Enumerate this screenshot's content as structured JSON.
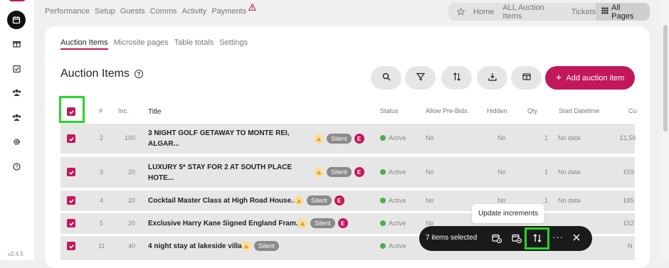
{
  "app": {
    "version": "v2.4.5"
  },
  "topnav": {
    "items": [
      "Performance",
      "Setup",
      "Guests",
      "Comms",
      "Activity",
      "Payments"
    ]
  },
  "breadcrumbs": {
    "home": "Home",
    "all_auction_items": "ALL Auction Items",
    "tickets": "Tickets",
    "all_pages": "All Pages"
  },
  "subtabs": [
    "Auction Items",
    "Microsite pages",
    "Table totals",
    "Settings"
  ],
  "page": {
    "title": "Auction Items",
    "add_button": "Add auction item"
  },
  "columns": {
    "num": "#",
    "inc": "Inc.",
    "title": "Title",
    "status": "Status",
    "allow_prebids": "Allow Pre-Bids",
    "hidden": "Hidden",
    "qty": "Qty",
    "start_datetime": "Start Datetime",
    "current": "Cu"
  },
  "rows": [
    {
      "num": "2",
      "inc": "100",
      "title_line1": "3 NIGHT GOLF GETAWAY TO MONTE REI,",
      "title_line2": "ALGAR...",
      "badge": "Silent",
      "e": "E",
      "status": "Active",
      "prebids": "No",
      "hidden": "No",
      "qty": "1",
      "start": "No data",
      "current": "£1,56"
    },
    {
      "num": "3",
      "inc": "20",
      "title_line1": "LUXURY 5* STAY FOR 2 AT SOUTH PLACE",
      "title_line2": "HOTE...",
      "badge": "Silent",
      "e": "E",
      "status": "Active",
      "prebids": "No",
      "hidden": "No",
      "qty": "1",
      "start": "No data",
      "current": "£59"
    },
    {
      "num": "4",
      "inc": "20",
      "title_line1": "Cocktail Master Class at High Road House...",
      "title_line2": "",
      "badge": "Silent",
      "e": "E",
      "status": "Active",
      "prebids": "No",
      "hidden": "No",
      "qty": "1",
      "start": "No data",
      "current": "£85"
    },
    {
      "num": "5",
      "inc": "20",
      "title_line1": "Exclusive Harry Kane Signed England Fram...",
      "title_line2": "",
      "badge": "Silent",
      "e": "E",
      "status": "Active",
      "prebids": "No",
      "hidden": "",
      "qty": "",
      "start": "",
      "current": "£52"
    },
    {
      "num": "11",
      "inc": "40",
      "title_line1": "4 night stay at lakeside villa",
      "title_line2": "",
      "badge": "Silent",
      "e": "",
      "status": "Active",
      "prebids": "No",
      "hidden": "",
      "qty": "",
      "start": "",
      "current": "N"
    }
  ],
  "selection_bar": {
    "label": "7 items selected",
    "tooltip": "Update increments"
  },
  "colors": {
    "accent": "#c2185b",
    "highlight": "#27d627",
    "active": "#4caf50"
  }
}
